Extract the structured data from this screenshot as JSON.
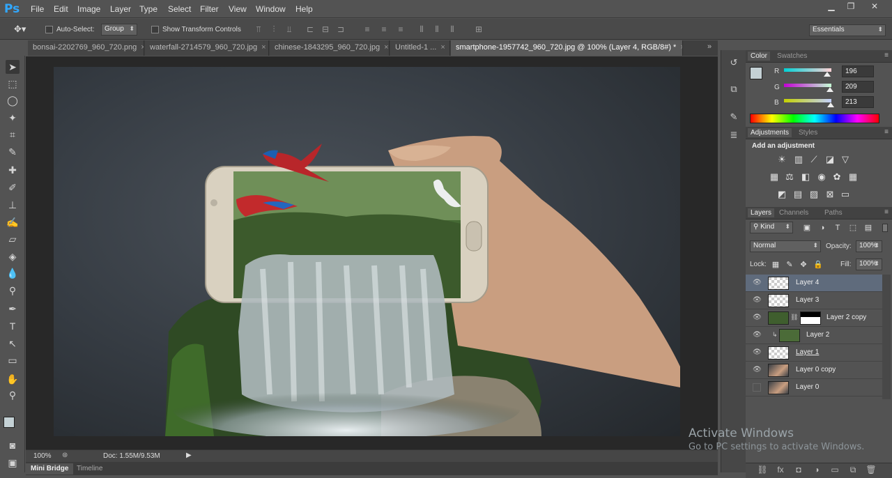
{
  "app": {
    "logo": "Ps"
  },
  "menu": [
    "File",
    "Edit",
    "Image",
    "Layer",
    "Type",
    "Select",
    "Filter",
    "View",
    "Window",
    "Help"
  ],
  "options": {
    "auto_select_label": "Auto-Select:",
    "auto_select_value": "Group",
    "transform_label": "Show Transform Controls",
    "workspace": "Essentials"
  },
  "tabs": [
    {
      "label": "bonsai-2202769_960_720.png",
      "active": false
    },
    {
      "label": "waterfall-2714579_960_720.jpg",
      "active": false
    },
    {
      "label": "chinese-1843295_960_720.jpg",
      "active": false
    },
    {
      "label": "Untitled-1 ...",
      "active": false
    },
    {
      "label": "smartphone-1957742_960_720.jpg @ 100% (Layer 4, RGB/8#) *",
      "active": true
    }
  ],
  "status": {
    "zoom": "100%",
    "doc": "Doc: 1.55M/9.53M"
  },
  "bottom_tabs": [
    "Mini Bridge",
    "Timeline"
  ],
  "color_panel": {
    "tabs": [
      "Color",
      "Swatches"
    ],
    "channels": [
      {
        "label": "R",
        "value": "196"
      },
      {
        "label": "G",
        "value": "209"
      },
      {
        "label": "B",
        "value": "213"
      }
    ],
    "swatch": "#c4d1d5"
  },
  "adjustments": {
    "tabs": [
      "Adjustments",
      "Styles"
    ],
    "title": "Add an adjustment"
  },
  "layers_panel": {
    "tabs": [
      "Layers",
      "Channels",
      "Paths"
    ],
    "kind": "Kind",
    "blend": "Normal",
    "opacity_label": "Opacity:",
    "opacity": "100%",
    "lock_label": "Lock:",
    "fill_label": "Fill:",
    "fill": "100%",
    "layers": [
      {
        "name": "Layer 4",
        "visible": true,
        "selected": true
      },
      {
        "name": "Layer 3",
        "visible": true,
        "selected": false
      },
      {
        "name": "Layer 2 copy",
        "visible": true,
        "selected": false
      },
      {
        "name": "Layer 2",
        "visible": true,
        "selected": false
      },
      {
        "name": "Layer 1",
        "visible": true,
        "selected": false
      },
      {
        "name": "Layer 0 copy",
        "visible": true,
        "selected": false
      },
      {
        "name": "Layer 0",
        "visible": false,
        "selected": false
      }
    ]
  },
  "watermark": {
    "line1": "Activate Windows",
    "line2": "Go to PC settings to activate Windows."
  }
}
